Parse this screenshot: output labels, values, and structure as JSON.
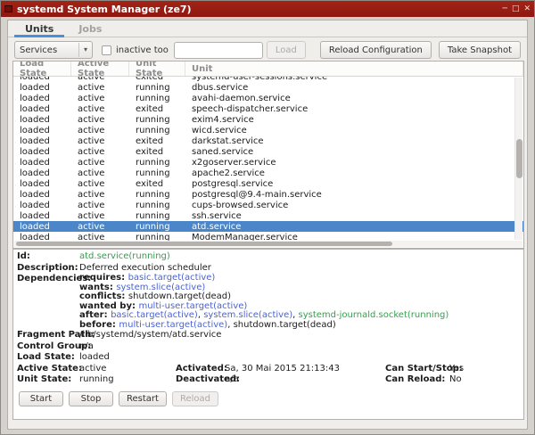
{
  "window": {
    "title": "systemd System Manager (ze7)",
    "controls": {
      "minimize": "─",
      "maximize": "□",
      "close": "✕"
    }
  },
  "colors": {
    "titlebar_red": "#9a1c12",
    "selection_blue": "#4a86c8",
    "tab_underline_blue": "#4a90d9",
    "link_blue": "#4a63d4",
    "running_green": "#33a04c"
  },
  "tabs": [
    {
      "label": "Units",
      "active": true
    },
    {
      "label": "Jobs",
      "active": false
    }
  ],
  "toolbar": {
    "filter_dropdown_value": "Services",
    "dropdown_arrow": "▾",
    "inactive_checkbox_label": "inactive too",
    "unit_input_value": "",
    "load_button": "Load",
    "reload_config_button": "Reload Configuration",
    "take_snapshot_button": "Take Snapshot"
  },
  "table": {
    "columns": [
      "Load State",
      "Active State",
      "Unit State",
      "Unit"
    ],
    "rows": [
      {
        "load_state": "loaded",
        "active_state": "active",
        "unit_state": "exited",
        "unit": "systemd-user-sessions.service",
        "selected": false
      },
      {
        "load_state": "loaded",
        "active_state": "active",
        "unit_state": "running",
        "unit": "dbus.service",
        "selected": false
      },
      {
        "load_state": "loaded",
        "active_state": "active",
        "unit_state": "running",
        "unit": "avahi-daemon.service",
        "selected": false
      },
      {
        "load_state": "loaded",
        "active_state": "active",
        "unit_state": "exited",
        "unit": "speech-dispatcher.service",
        "selected": false
      },
      {
        "load_state": "loaded",
        "active_state": "active",
        "unit_state": "running",
        "unit": "exim4.service",
        "selected": false
      },
      {
        "load_state": "loaded",
        "active_state": "active",
        "unit_state": "running",
        "unit": "wicd.service",
        "selected": false
      },
      {
        "load_state": "loaded",
        "active_state": "active",
        "unit_state": "exited",
        "unit": "darkstat.service",
        "selected": false
      },
      {
        "load_state": "loaded",
        "active_state": "active",
        "unit_state": "exited",
        "unit": "saned.service",
        "selected": false
      },
      {
        "load_state": "loaded",
        "active_state": "active",
        "unit_state": "running",
        "unit": "x2goserver.service",
        "selected": false
      },
      {
        "load_state": "loaded",
        "active_state": "active",
        "unit_state": "running",
        "unit": "apache2.service",
        "selected": false
      },
      {
        "load_state": "loaded",
        "active_state": "active",
        "unit_state": "exited",
        "unit": "postgresql.service",
        "selected": false
      },
      {
        "load_state": "loaded",
        "active_state": "active",
        "unit_state": "running",
        "unit": "postgresql@9.4-main.service",
        "selected": false
      },
      {
        "load_state": "loaded",
        "active_state": "active",
        "unit_state": "running",
        "unit": "cups-browsed.service",
        "selected": false
      },
      {
        "load_state": "loaded",
        "active_state": "active",
        "unit_state": "running",
        "unit": "ssh.service",
        "selected": false
      },
      {
        "load_state": "loaded",
        "active_state": "active",
        "unit_state": "running",
        "unit": "atd.service",
        "selected": true
      },
      {
        "load_state": "loaded",
        "active_state": "active",
        "unit_state": "running",
        "unit": "ModemManager.service",
        "selected": false
      }
    ]
  },
  "details": {
    "id": {
      "label": "Id:",
      "value": "atd.service(running)"
    },
    "description": {
      "label": "Description:",
      "value": "Deferred execution scheduler"
    },
    "dependencies": {
      "label": "Dependencies:",
      "lines": [
        {
          "key": "requires:",
          "parts": [
            {
              "text": "basic.target(active)",
              "style": "link"
            }
          ]
        },
        {
          "key": "wants:",
          "parts": [
            {
              "text": "system.slice(active)",
              "style": "link"
            }
          ]
        },
        {
          "key": "conflicts:",
          "parts": [
            {
              "text": "shutdown.target(dead)",
              "style": "plain"
            }
          ]
        },
        {
          "key": "wanted by:",
          "parts": [
            {
              "text": "multi-user.target(active)",
              "style": "link"
            }
          ]
        },
        {
          "key": "after:",
          "parts": [
            {
              "text": "basic.target(active)",
              "style": "link"
            },
            {
              "text": ", ",
              "style": "plain"
            },
            {
              "text": "system.slice(active)",
              "style": "link"
            },
            {
              "text": ", ",
              "style": "plain"
            },
            {
              "text": "systemd-journald.socket(running)",
              "style": "green"
            }
          ]
        },
        {
          "key": "before:",
          "parts": [
            {
              "text": "multi-user.target(active)",
              "style": "link"
            },
            {
              "text": ", ",
              "style": "plain"
            },
            {
              "text": "shutdown.target(dead)",
              "style": "plain"
            }
          ]
        }
      ]
    },
    "fragment_path": {
      "label": "Fragment Path:",
      "value": "/lib/systemd/system/atd.service"
    },
    "control_group": {
      "label": "Control Group:",
      "value": "n/a"
    },
    "load_state": {
      "label": "Load State:",
      "value": "loaded"
    },
    "active_state": {
      "label": "Active State:",
      "value": "active",
      "col2_label": "Activated:",
      "col2_value": "Sa, 30 Mai 2015 21:13:43",
      "col3_label": "Can Start/Stop:",
      "col3_value": "Yes"
    },
    "unit_state": {
      "label": "Unit State:",
      "value": "running",
      "col2_label": "Deactivated:",
      "col2_value": "n/a",
      "col3_label": "Can Reload:",
      "col3_value": "No"
    }
  },
  "actions": {
    "start": "Start",
    "stop": "Stop",
    "restart": "Restart",
    "reload": "Reload"
  }
}
